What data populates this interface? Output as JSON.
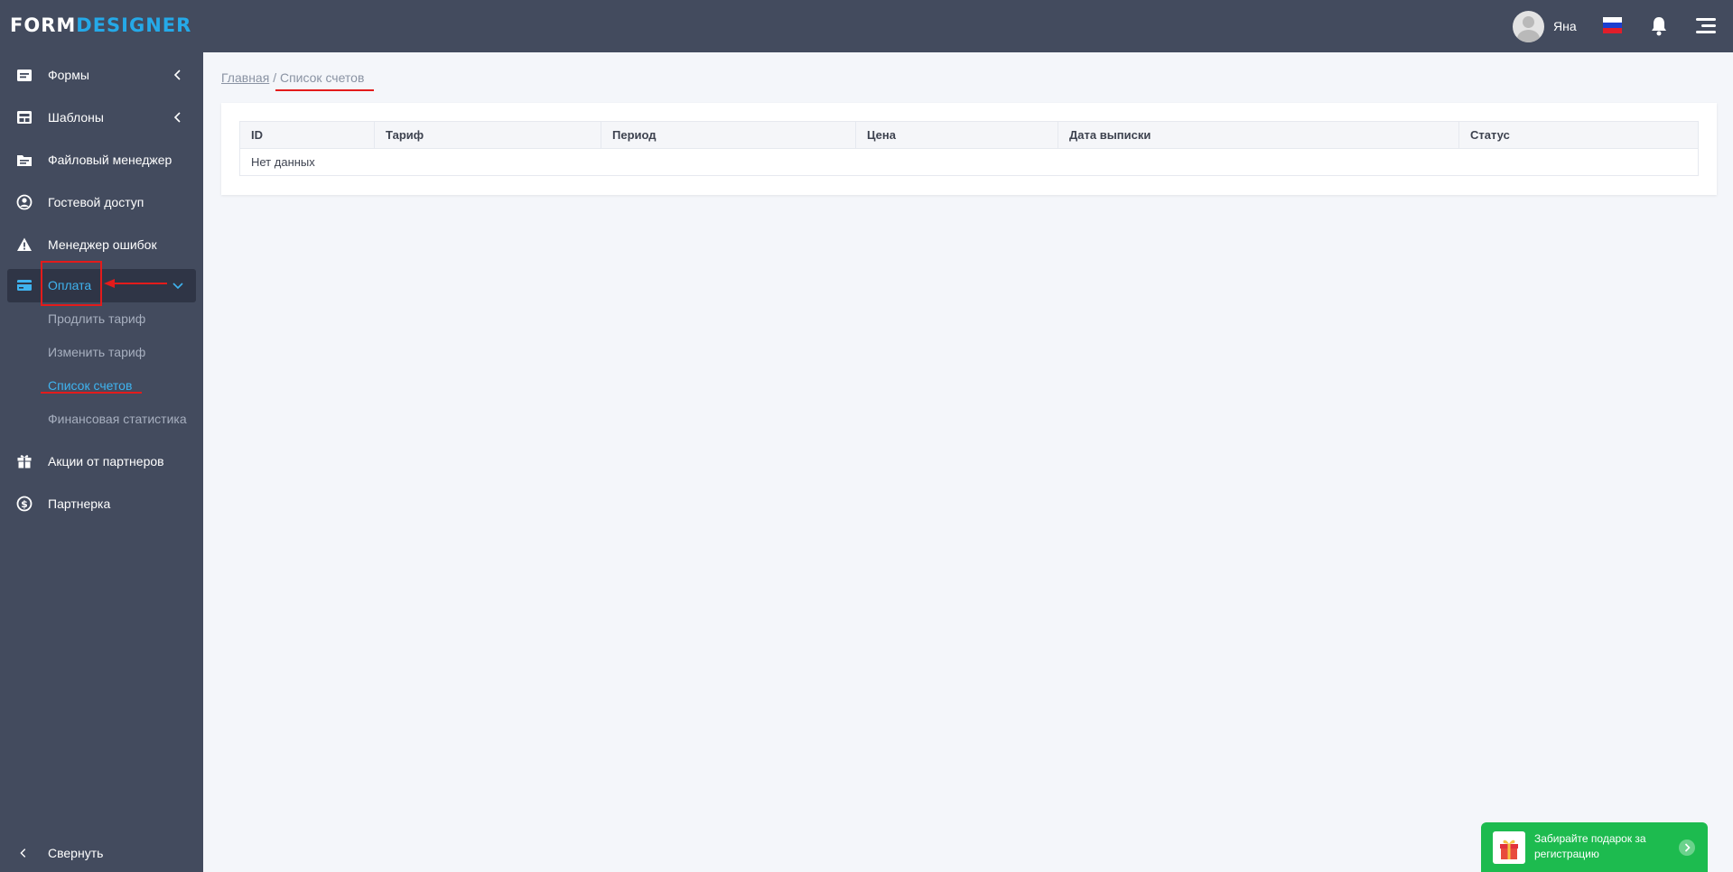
{
  "header": {
    "logo_part1": "FORM",
    "logo_part2": "DESIGNER",
    "username": "Яна"
  },
  "sidebar": {
    "items": [
      {
        "label": "Формы",
        "icon": "forms-icon"
      },
      {
        "label": "Шаблоны",
        "icon": "templates-icon"
      },
      {
        "label": "Файловый менеджер",
        "icon": "folder-icon"
      },
      {
        "label": "Гостевой доступ",
        "icon": "user-circle-icon"
      },
      {
        "label": "Менеджер ошибок",
        "icon": "warning-icon"
      },
      {
        "label": "Оплата",
        "icon": "credit-card-icon"
      },
      {
        "label": "Акции от партнеров",
        "icon": "gift-icon"
      },
      {
        "label": "Партнерка",
        "icon": "dollar-circle-icon"
      }
    ],
    "payment_sub": [
      "Продлить тариф",
      "Изменить тариф",
      "Список счетов",
      "Финансовая статистика"
    ],
    "collapse_label": "Свернуть"
  },
  "breadcrumb": {
    "home": "Главная",
    "separator": "/",
    "current": "Список счетов"
  },
  "table": {
    "columns": [
      "ID",
      "Тариф",
      "Период",
      "Цена",
      "Дата выписки",
      "Статус"
    ],
    "empty_text": "Нет данных"
  },
  "promo": {
    "text": "Забирайте подарок за регистрацию"
  },
  "colors": {
    "sidebar_bg": "#434b5e",
    "accent": "#3fb3ef",
    "promo_bg": "#1dbb4f",
    "annotation_red": "#e31b1b"
  }
}
